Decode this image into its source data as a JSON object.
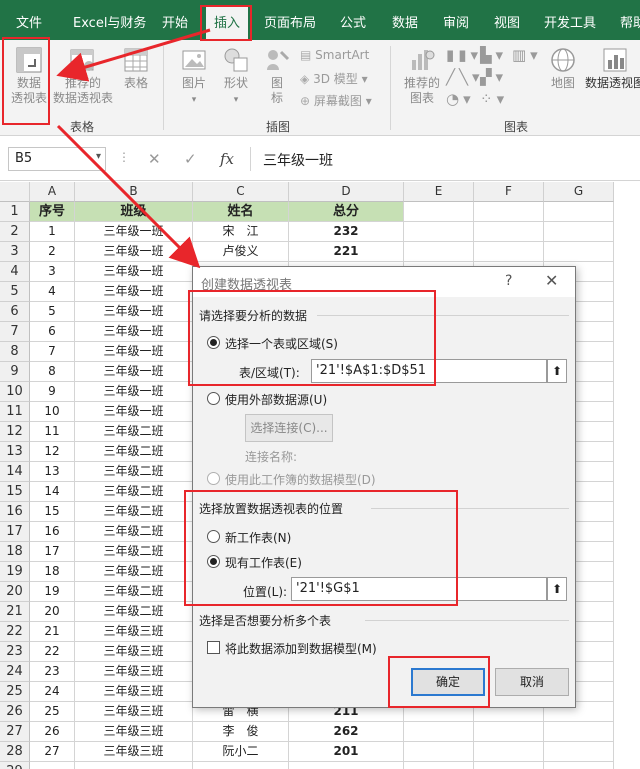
{
  "tabs": [
    "文件",
    "Excel与财务",
    "开始",
    "插入",
    "页面布局",
    "公式",
    "数据",
    "审阅",
    "视图",
    "开发工具",
    "帮助"
  ],
  "active_tab_index": 3,
  "ribbon": {
    "pivot_line1": "数据",
    "pivot_line2": "透视表",
    "recommended_pivot_line1": "推荐的",
    "recommended_pivot_line2": "数据透视表",
    "table": "表格",
    "pictures": "图片",
    "shapes": "形状",
    "icons_line1": "图",
    "icons_line2": "标",
    "smartart": "SmartArt",
    "model3d": "3D 模型",
    "screenshot": "屏幕截图",
    "rec_charts_line1": "推荐的",
    "rec_charts_line2": "图表",
    "maps": "地图",
    "pivot_chart": "数据透视图",
    "group_tables": "表格",
    "group_illustrations": "插图",
    "group_charts": "图表"
  },
  "formula_bar": {
    "name_box": "B5",
    "fx": "fx",
    "content": "三年级一班"
  },
  "columns": [
    "A",
    "B",
    "C",
    "D",
    "E",
    "F",
    "G"
  ],
  "sheet_headers": [
    "序号",
    "班级",
    "姓名",
    "总分"
  ],
  "rows": [
    [
      "1",
      "三年级一班",
      "宋　江",
      "232"
    ],
    [
      "2",
      "三年级一班",
      "卢俊义",
      "221"
    ],
    [
      "3",
      "三年级一班",
      "",
      ""
    ],
    [
      "4",
      "三年级一班",
      "",
      ""
    ],
    [
      "5",
      "三年级一班",
      "",
      ""
    ],
    [
      "6",
      "三年级一班",
      "",
      ""
    ],
    [
      "7",
      "三年级一班",
      "",
      ""
    ],
    [
      "8",
      "三年级一班",
      "",
      ""
    ],
    [
      "9",
      "三年级一班",
      "",
      ""
    ],
    [
      "10",
      "三年级一班",
      "",
      ""
    ],
    [
      "11",
      "三年级二班",
      "",
      ""
    ],
    [
      "12",
      "三年级二班",
      "",
      ""
    ],
    [
      "13",
      "三年级二班",
      "",
      ""
    ],
    [
      "14",
      "三年级二班",
      "",
      ""
    ],
    [
      "15",
      "三年级二班",
      "",
      ""
    ],
    [
      "16",
      "三年级二班",
      "",
      ""
    ],
    [
      "17",
      "三年级二班",
      "",
      ""
    ],
    [
      "18",
      "三年级二班",
      "",
      ""
    ],
    [
      "19",
      "三年级二班",
      "",
      ""
    ],
    [
      "20",
      "三年级二班",
      "",
      ""
    ],
    [
      "21",
      "三年级三班",
      "",
      ""
    ],
    [
      "22",
      "三年级三班",
      "",
      ""
    ],
    [
      "23",
      "三年级三班",
      "",
      ""
    ],
    [
      "24",
      "三年级三班",
      "",
      ""
    ],
    [
      "25",
      "三年级三班",
      "雷　横",
      "211"
    ],
    [
      "26",
      "三年级三班",
      "李　俊",
      "262"
    ],
    [
      "27",
      "三年级三班",
      "阮小二",
      "201"
    ]
  ],
  "dialog": {
    "title": "创建数据透视表",
    "help": "?",
    "close": "✕",
    "section1": "请选择要分析的数据",
    "opt_select_range": "选择一个表或区域(S)",
    "range_label": "表/区域(T):",
    "range_value": "'21'!$A$1:$D$51",
    "opt_external": "使用外部数据源(U)",
    "choose_connection": "选择连接(C)...",
    "connection_name": "连接名称:",
    "opt_data_model": "使用此工作簿的数据模型(D)",
    "section2": "选择放置数据透视表的位置",
    "opt_new_sheet": "新工作表(N)",
    "opt_existing_sheet": "现有工作表(E)",
    "location_label": "位置(L):",
    "location_value": "'21'!$G$1",
    "section3": "选择是否想要分析多个表",
    "add_to_model": "将此数据添加到数据模型(M)",
    "ok": "确定",
    "cancel": "取消"
  },
  "colors": {
    "excel_green": "#217346",
    "header_fill": "#c6e0b4",
    "annotation_red": "#e8262b"
  }
}
